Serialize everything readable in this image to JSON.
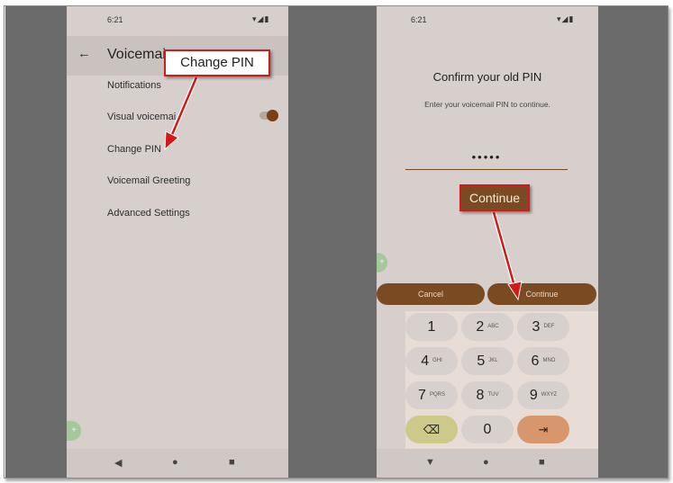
{
  "left_phone": {
    "status_time": "6:21",
    "status_icons": "▾◢▮",
    "header_title": "Voicemai",
    "menu": [
      {
        "label": "Notifications"
      },
      {
        "label": "Visual voicemai"
      },
      {
        "label": "Change PIN"
      },
      {
        "label": "Voicemail Greeting"
      },
      {
        "label": "Advanced Settings"
      }
    ],
    "visual_voicemail_toggle": "on",
    "fab": "+",
    "nav": {
      "back": "◀",
      "home": "●",
      "recents": "■"
    }
  },
  "right_phone": {
    "status_time": "6:21",
    "status_icons": "▾◢▮",
    "title": "Confirm your old PIN",
    "subtitle": "Enter your voicemail PIN to continue.",
    "pin_value": "•••••",
    "cancel_label": "Cancel",
    "continue_label": "Continue",
    "fab": "+",
    "keys": [
      {
        "num": "1",
        "letters": ""
      },
      {
        "num": "2",
        "letters": "ABC"
      },
      {
        "num": "3",
        "letters": "DEF"
      },
      {
        "num": "4",
        "letters": "GHI"
      },
      {
        "num": "5",
        "letters": "JKL"
      },
      {
        "num": "6",
        "letters": "MNO"
      },
      {
        "num": "7",
        "letters": "PQRS"
      },
      {
        "num": "8",
        "letters": "TUV"
      },
      {
        "num": "9",
        "letters": "WXYZ"
      },
      {
        "num": "⌫",
        "letters": ""
      },
      {
        "num": "0",
        "letters": ""
      },
      {
        "num": "⇥",
        "letters": ""
      }
    ],
    "nav": {
      "back": "▼",
      "home": "●",
      "recents": "■"
    }
  },
  "callouts": {
    "change_pin": "Change PIN",
    "continue": "Continue"
  },
  "colors": {
    "accent_brown": "#7a4a22",
    "callout_red": "#d11a1a"
  }
}
